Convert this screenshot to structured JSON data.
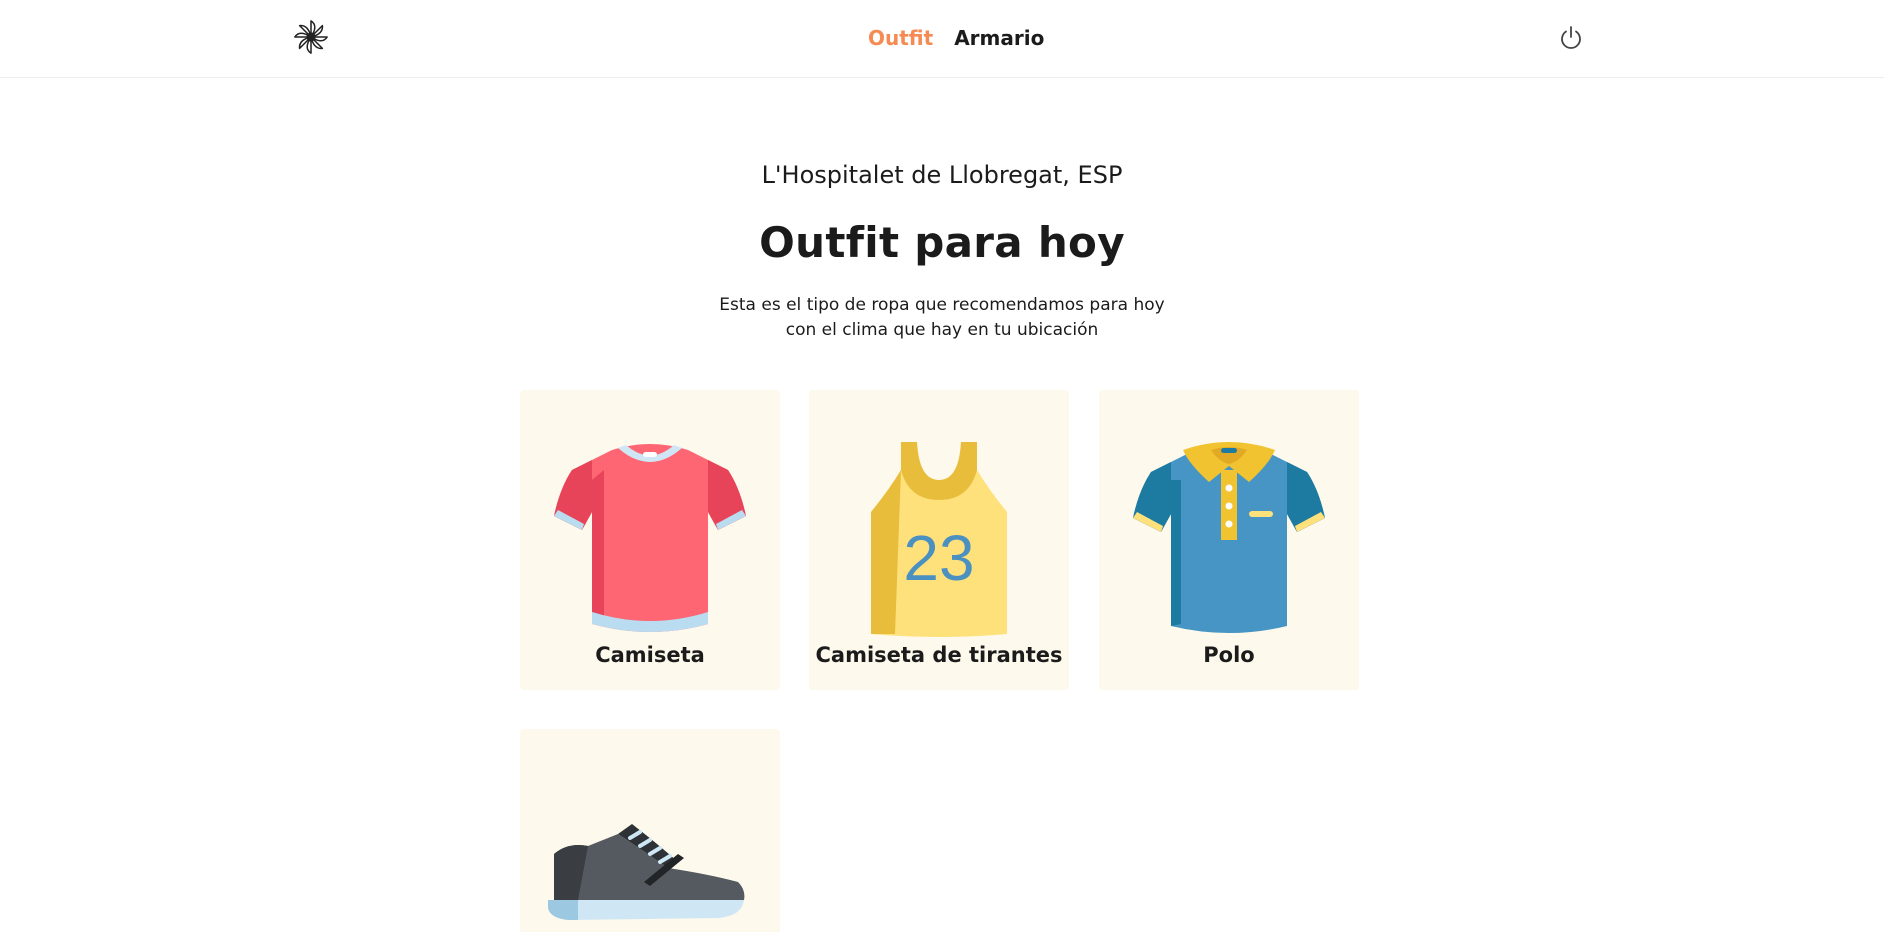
{
  "nav": {
    "outfit_label": "Outfit",
    "armario_label": "Armario"
  },
  "main": {
    "location": "L'Hospitalet de Llobregat, ESP",
    "title": "Outfit para hoy",
    "description_line1": "Esta es el tipo de ropa que recomendamos para hoy",
    "description_line2": "con el clima que hay en tu ubicación"
  },
  "items": [
    {
      "label": "Camiseta",
      "icon": "tshirt-icon"
    },
    {
      "label": "Camiseta de tirantes",
      "icon": "tank-top-icon",
      "number": "23"
    },
    {
      "label": "Polo",
      "icon": "polo-shirt-icon"
    },
    {
      "label": "",
      "icon": "sneaker-icon"
    }
  ],
  "colors": {
    "accent": "#f58a52",
    "card_bg": "#fdf9ec",
    "text": "#1b1b1b"
  }
}
